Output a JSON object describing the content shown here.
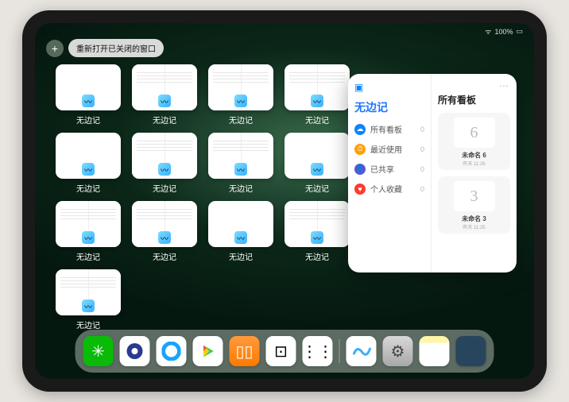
{
  "status": {
    "battery": "100%",
    "wifi": "•••"
  },
  "reopen": {
    "plus": "+",
    "label": "重新打开已关闭的窗口"
  },
  "thumbs": {
    "label": "无边记",
    "layouts": [
      "blank",
      "split",
      "split",
      "split",
      "blank",
      "split",
      "split",
      "blank",
      "split",
      "split",
      "blank",
      "split",
      "split"
    ]
  },
  "popup": {
    "title": "无边记",
    "rightTitle": "所有看板",
    "rows": [
      {
        "label": "所有看板",
        "count": "0",
        "color": "blue",
        "glyph": "☁"
      },
      {
        "label": "最近使用",
        "count": "0",
        "color": "yellow",
        "glyph": "⏱"
      },
      {
        "label": "已共享",
        "count": "0",
        "color": "indigo",
        "glyph": "👤"
      },
      {
        "label": "个人收藏",
        "count": "0",
        "color": "red",
        "glyph": "♥"
      }
    ],
    "boards": [
      {
        "scribble": "6",
        "name": "未命名 6",
        "sub": "昨天 11:26"
      },
      {
        "scribble": "3",
        "name": "未命名 3",
        "sub": "昨天 11:25"
      }
    ]
  },
  "dock": [
    {
      "name": "wechat",
      "class": "d-wechat",
      "glyph": "✳"
    },
    {
      "name": "browser",
      "class": "d-browser",
      "glyph": ""
    },
    {
      "name": "qq-browser",
      "class": "d-qq",
      "glyph": ""
    },
    {
      "name": "play",
      "class": "d-play",
      "glyph": ""
    },
    {
      "name": "books",
      "class": "d-books",
      "glyph": "▯▯"
    },
    {
      "name": "game",
      "class": "d-dice",
      "glyph": "⊡"
    },
    {
      "name": "share",
      "class": "d-dots",
      "glyph": "⋮⋮"
    },
    {
      "name": "freeform",
      "class": "d-freeform",
      "glyph": ""
    },
    {
      "name": "settings",
      "class": "d-settings",
      "glyph": "⚙"
    },
    {
      "name": "notes",
      "class": "d-notes",
      "glyph": ""
    },
    {
      "name": "recents",
      "class": "d-multi",
      "glyph": ""
    }
  ]
}
